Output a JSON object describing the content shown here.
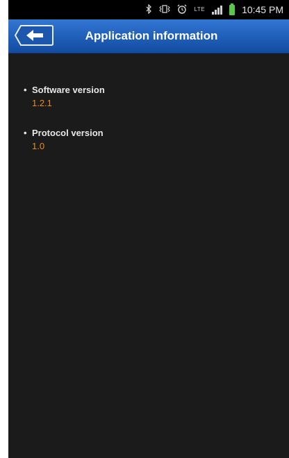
{
  "status_bar": {
    "icons": [
      "bluetooth-icon",
      "vibrate-icon",
      "alarm-icon",
      "lte-icon",
      "signal-icon",
      "battery-icon"
    ],
    "lte_label": "LTE",
    "time": "10:45 PM",
    "battery_color": "#5ac74b"
  },
  "action_bar": {
    "back_icon": "back-arrow-icon",
    "title": "Application information",
    "color": "#2a6acb"
  },
  "info": {
    "items": [
      {
        "label": "Software version",
        "value": "1.2.1"
      },
      {
        "label": "Protocol version",
        "value": "1.0"
      }
    ],
    "value_color": "#ee8a16"
  }
}
